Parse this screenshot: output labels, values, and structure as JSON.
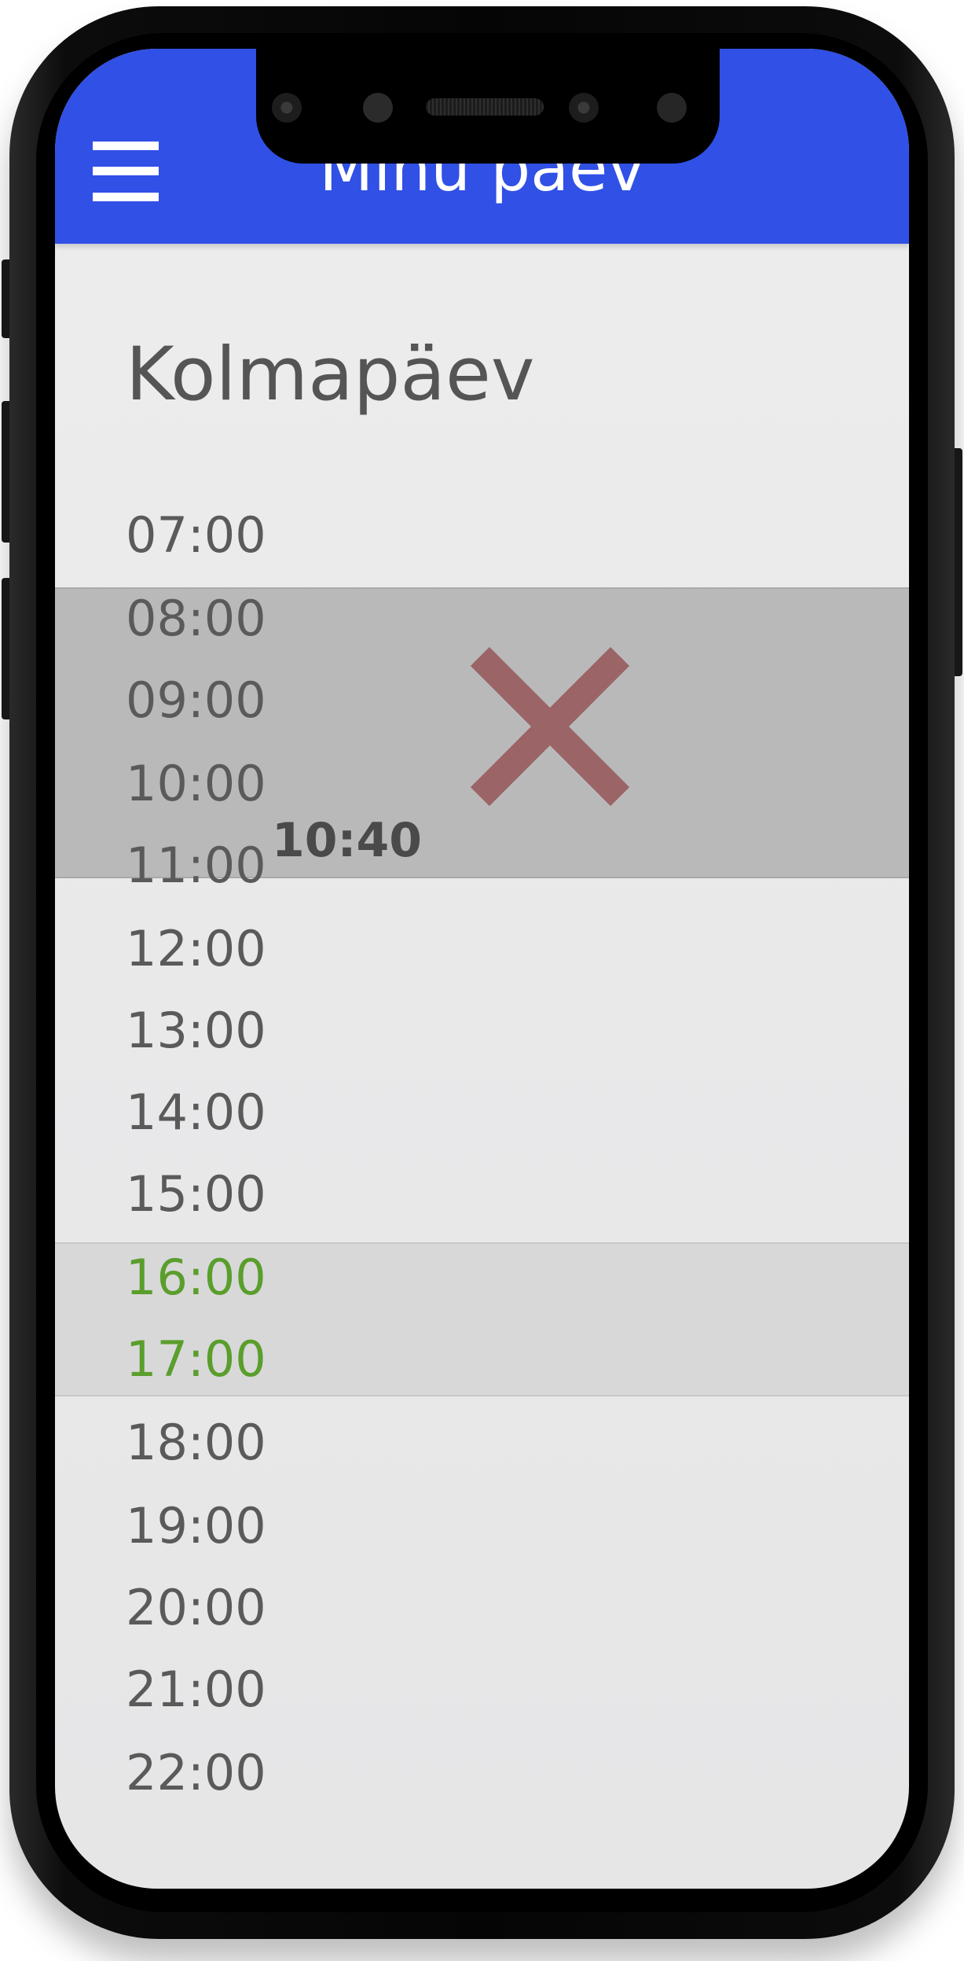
{
  "app_bar": {
    "title": "Minu päev",
    "background_color": "#3050e6",
    "menu_icon": "hamburger-menu-icon"
  },
  "day": {
    "title": "Kolmapäev"
  },
  "schedule": {
    "hours": [
      "07:00",
      "08:00",
      "09:00",
      "10:00",
      "11:00",
      "12:00",
      "13:00",
      "14:00",
      "15:00",
      "16:00",
      "17:00",
      "18:00",
      "19:00",
      "20:00",
      "21:00",
      "22:00"
    ],
    "highlighted_hours": [
      "16:00",
      "17:00"
    ],
    "highlight_color": "#5a9e2c",
    "current_time": "10:40",
    "blocked_icon": "close-x-icon",
    "blocked_icon_color": "#9b6466"
  }
}
